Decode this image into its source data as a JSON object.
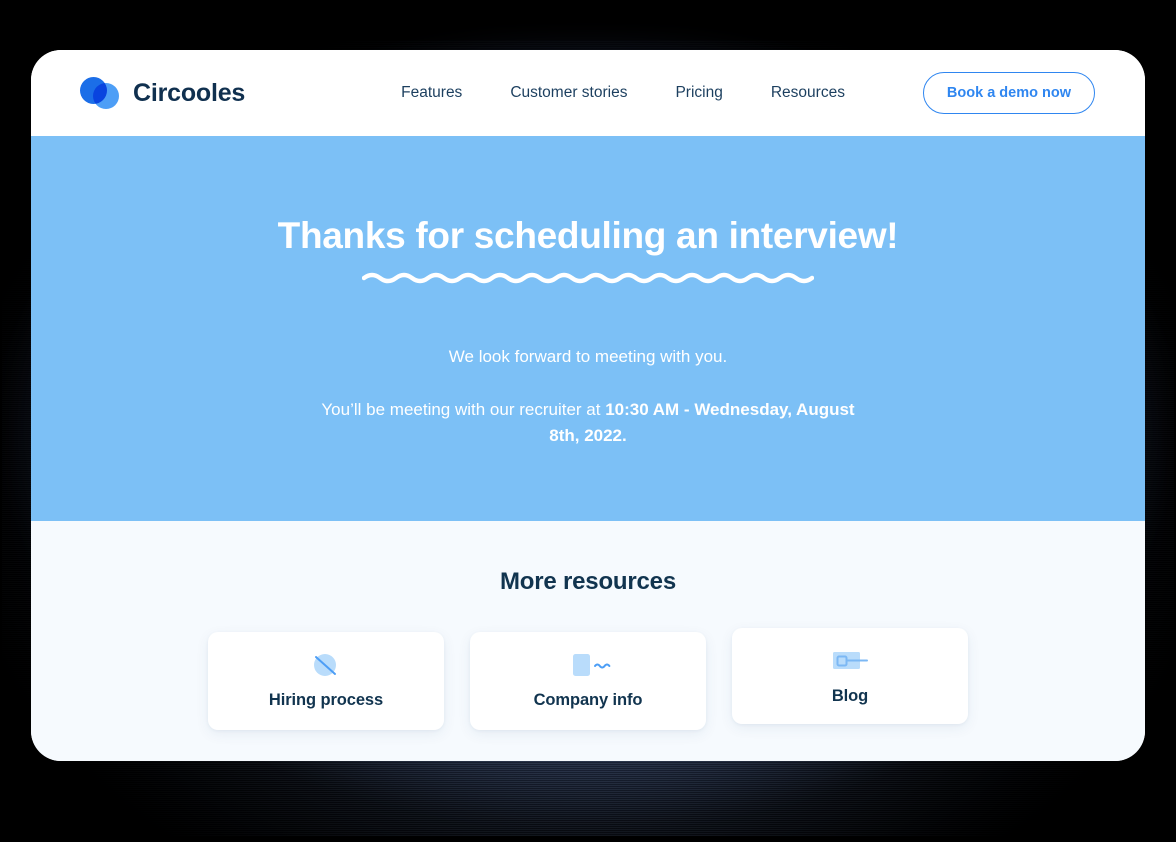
{
  "header": {
    "brand_name": "Circooles",
    "logo_icon": "circles-logo-icon",
    "nav": [
      {
        "label": "Features"
      },
      {
        "label": "Customer stories"
      },
      {
        "label": "Pricing"
      },
      {
        "label": "Resources"
      }
    ],
    "cta_label": "Book a demo now"
  },
  "hero": {
    "title": "Thanks for scheduling an interview!",
    "divider_icon": "squiggle-wave-icon",
    "line1": "We look forward to meeting with you.",
    "line2_prefix": "You’ll be meeting with our recruiter at ",
    "line2_highlight": "10:30 AM - Wednesday, August 8th, 2022."
  },
  "resources": {
    "title": "More resources",
    "cards": [
      {
        "label": "Hiring process",
        "icon": "circle-slash-icon"
      },
      {
        "label": "Company info",
        "icon": "document-squiggle-icon"
      },
      {
        "label": "Blog",
        "icon": "article-card-icon"
      }
    ]
  },
  "colors": {
    "hero_blue": "#7cc0f6",
    "resources_bg": "#f6fafe",
    "navy_text": "#11344f",
    "accent_blue": "#2f86f0",
    "logo_dark": "#1b6ee8",
    "logo_light": "#4d9ef6",
    "icon_fill": "#b9dcfb",
    "icon_stroke": "#4d9ef6",
    "page_bg": "#000000",
    "card_bg": "#ffffff"
  }
}
